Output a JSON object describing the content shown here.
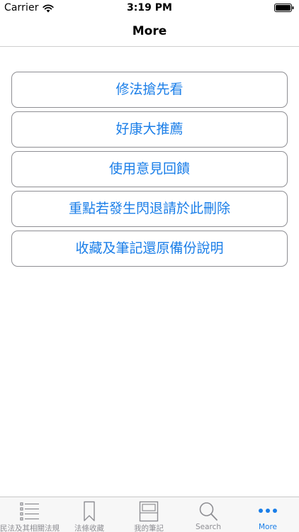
{
  "status_bar": {
    "carrier": "Carrier",
    "time": "3:19 PM"
  },
  "nav": {
    "title": "More"
  },
  "menu": {
    "items": [
      {
        "label": "修法搶先看"
      },
      {
        "label": "好康大推薦"
      },
      {
        "label": "使用意見回饋"
      },
      {
        "label": "重點若發生閃退請於此刪除"
      },
      {
        "label": "收藏及筆記還原備份說明"
      }
    ]
  },
  "tab_bar": {
    "tabs": [
      {
        "label": "民法及其相關法規",
        "icon": "list-icon"
      },
      {
        "label": "法條收藏",
        "icon": "bookmark-icon"
      },
      {
        "label": "我的筆記",
        "icon": "notebook-icon"
      },
      {
        "label": "Search",
        "icon": "search-icon"
      },
      {
        "label": "More",
        "icon": "more-icon",
        "active": true
      }
    ]
  },
  "colors": {
    "accent": "#1a7ee8",
    "inactive": "#8e8e93",
    "button_border": "#8e8e93"
  }
}
